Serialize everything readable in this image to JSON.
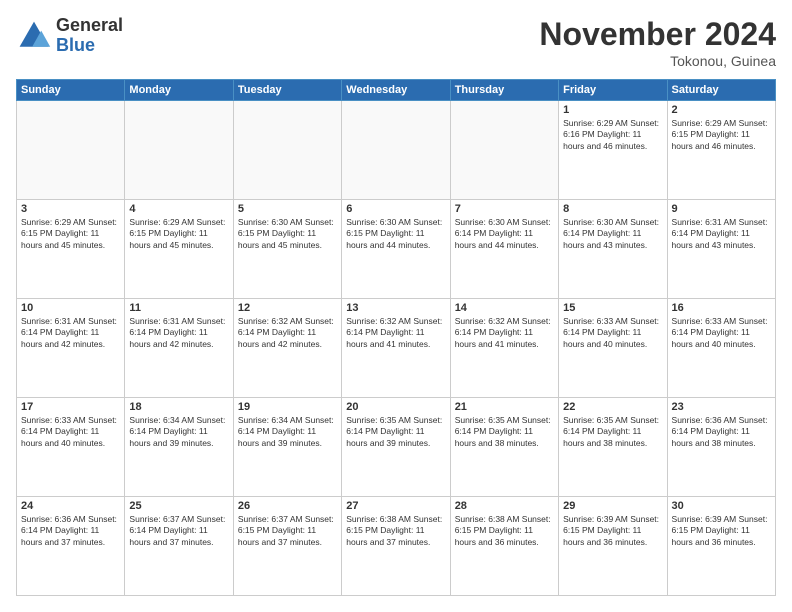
{
  "logo": {
    "general": "General",
    "blue": "Blue"
  },
  "title": "November 2024",
  "location": "Tokonou, Guinea",
  "days_of_week": [
    "Sunday",
    "Monday",
    "Tuesday",
    "Wednesday",
    "Thursday",
    "Friday",
    "Saturday"
  ],
  "weeks": [
    [
      {
        "day": "",
        "info": ""
      },
      {
        "day": "",
        "info": ""
      },
      {
        "day": "",
        "info": ""
      },
      {
        "day": "",
        "info": ""
      },
      {
        "day": "",
        "info": ""
      },
      {
        "day": "1",
        "info": "Sunrise: 6:29 AM\nSunset: 6:16 PM\nDaylight: 11 hours\nand 46 minutes."
      },
      {
        "day": "2",
        "info": "Sunrise: 6:29 AM\nSunset: 6:15 PM\nDaylight: 11 hours\nand 46 minutes."
      }
    ],
    [
      {
        "day": "3",
        "info": "Sunrise: 6:29 AM\nSunset: 6:15 PM\nDaylight: 11 hours\nand 45 minutes."
      },
      {
        "day": "4",
        "info": "Sunrise: 6:29 AM\nSunset: 6:15 PM\nDaylight: 11 hours\nand 45 minutes."
      },
      {
        "day": "5",
        "info": "Sunrise: 6:30 AM\nSunset: 6:15 PM\nDaylight: 11 hours\nand 45 minutes."
      },
      {
        "day": "6",
        "info": "Sunrise: 6:30 AM\nSunset: 6:15 PM\nDaylight: 11 hours\nand 44 minutes."
      },
      {
        "day": "7",
        "info": "Sunrise: 6:30 AM\nSunset: 6:14 PM\nDaylight: 11 hours\nand 44 minutes."
      },
      {
        "day": "8",
        "info": "Sunrise: 6:30 AM\nSunset: 6:14 PM\nDaylight: 11 hours\nand 43 minutes."
      },
      {
        "day": "9",
        "info": "Sunrise: 6:31 AM\nSunset: 6:14 PM\nDaylight: 11 hours\nand 43 minutes."
      }
    ],
    [
      {
        "day": "10",
        "info": "Sunrise: 6:31 AM\nSunset: 6:14 PM\nDaylight: 11 hours\nand 42 minutes."
      },
      {
        "day": "11",
        "info": "Sunrise: 6:31 AM\nSunset: 6:14 PM\nDaylight: 11 hours\nand 42 minutes."
      },
      {
        "day": "12",
        "info": "Sunrise: 6:32 AM\nSunset: 6:14 PM\nDaylight: 11 hours\nand 42 minutes."
      },
      {
        "day": "13",
        "info": "Sunrise: 6:32 AM\nSunset: 6:14 PM\nDaylight: 11 hours\nand 41 minutes."
      },
      {
        "day": "14",
        "info": "Sunrise: 6:32 AM\nSunset: 6:14 PM\nDaylight: 11 hours\nand 41 minutes."
      },
      {
        "day": "15",
        "info": "Sunrise: 6:33 AM\nSunset: 6:14 PM\nDaylight: 11 hours\nand 40 minutes."
      },
      {
        "day": "16",
        "info": "Sunrise: 6:33 AM\nSunset: 6:14 PM\nDaylight: 11 hours\nand 40 minutes."
      }
    ],
    [
      {
        "day": "17",
        "info": "Sunrise: 6:33 AM\nSunset: 6:14 PM\nDaylight: 11 hours\nand 40 minutes."
      },
      {
        "day": "18",
        "info": "Sunrise: 6:34 AM\nSunset: 6:14 PM\nDaylight: 11 hours\nand 39 minutes."
      },
      {
        "day": "19",
        "info": "Sunrise: 6:34 AM\nSunset: 6:14 PM\nDaylight: 11 hours\nand 39 minutes."
      },
      {
        "day": "20",
        "info": "Sunrise: 6:35 AM\nSunset: 6:14 PM\nDaylight: 11 hours\nand 39 minutes."
      },
      {
        "day": "21",
        "info": "Sunrise: 6:35 AM\nSunset: 6:14 PM\nDaylight: 11 hours\nand 38 minutes."
      },
      {
        "day": "22",
        "info": "Sunrise: 6:35 AM\nSunset: 6:14 PM\nDaylight: 11 hours\nand 38 minutes."
      },
      {
        "day": "23",
        "info": "Sunrise: 6:36 AM\nSunset: 6:14 PM\nDaylight: 11 hours\nand 38 minutes."
      }
    ],
    [
      {
        "day": "24",
        "info": "Sunrise: 6:36 AM\nSunset: 6:14 PM\nDaylight: 11 hours\nand 37 minutes."
      },
      {
        "day": "25",
        "info": "Sunrise: 6:37 AM\nSunset: 6:14 PM\nDaylight: 11 hours\nand 37 minutes."
      },
      {
        "day": "26",
        "info": "Sunrise: 6:37 AM\nSunset: 6:15 PM\nDaylight: 11 hours\nand 37 minutes."
      },
      {
        "day": "27",
        "info": "Sunrise: 6:38 AM\nSunset: 6:15 PM\nDaylight: 11 hours\nand 37 minutes."
      },
      {
        "day": "28",
        "info": "Sunrise: 6:38 AM\nSunset: 6:15 PM\nDaylight: 11 hours\nand 36 minutes."
      },
      {
        "day": "29",
        "info": "Sunrise: 6:39 AM\nSunset: 6:15 PM\nDaylight: 11 hours\nand 36 minutes."
      },
      {
        "day": "30",
        "info": "Sunrise: 6:39 AM\nSunset: 6:15 PM\nDaylight: 11 hours\nand 36 minutes."
      }
    ]
  ]
}
